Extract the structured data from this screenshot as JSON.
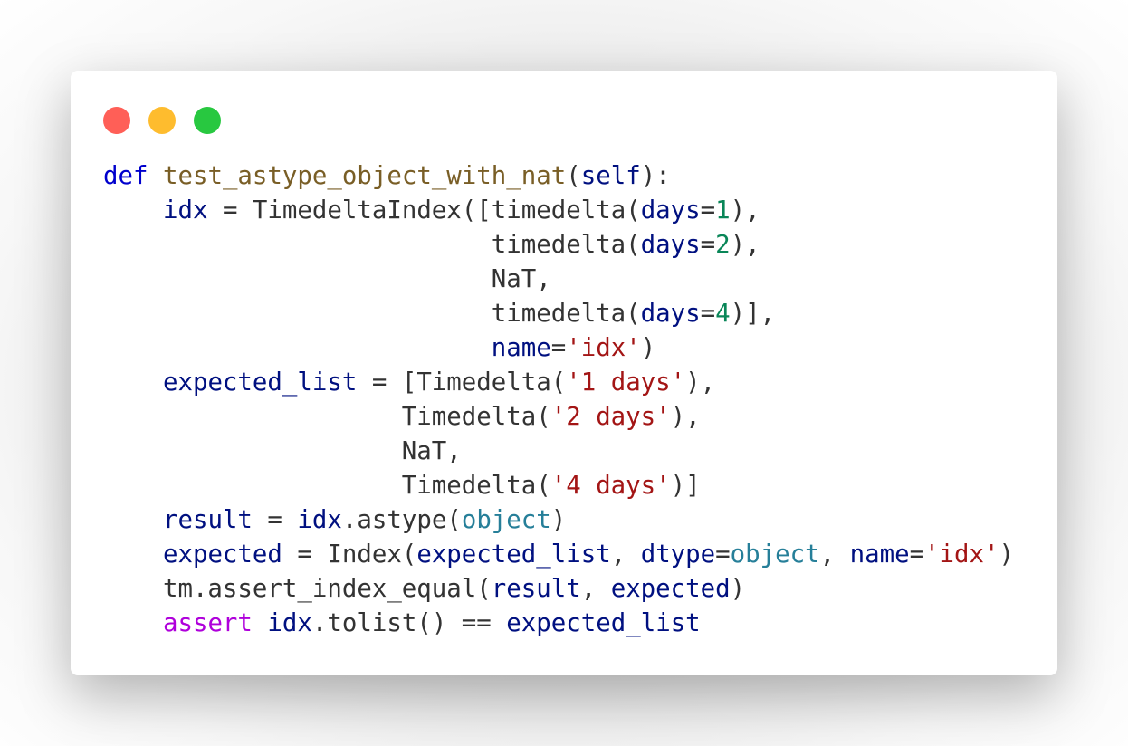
{
  "window": {
    "controls": {
      "close_color": "#ff5f57",
      "minimize_color": "#febc2e",
      "zoom_color": "#28c840"
    }
  },
  "colors": {
    "keyword": "#0000cd",
    "function_name": "#795e26",
    "variable": "#001080",
    "number": "#098658",
    "string": "#a31515",
    "builtin": "#267f99",
    "control": "#af00db",
    "default": "#333333"
  },
  "code": {
    "lines": [
      [
        {
          "text": "def",
          "cls": "kw"
        },
        {
          "text": " "
        },
        {
          "text": "test_astype_object_with_nat",
          "cls": "fn"
        },
        {
          "text": "("
        },
        {
          "text": "self",
          "cls": "var"
        },
        {
          "text": "):"
        }
      ],
      [
        {
          "text": "    "
        },
        {
          "text": "idx",
          "cls": "var"
        },
        {
          "text": " = TimedeltaIndex([timedelta("
        },
        {
          "text": "days",
          "cls": "var"
        },
        {
          "text": "="
        },
        {
          "text": "1",
          "cls": "num"
        },
        {
          "text": "),"
        }
      ],
      [
        {
          "text": "                          timedelta("
        },
        {
          "text": "days",
          "cls": "var"
        },
        {
          "text": "="
        },
        {
          "text": "2",
          "cls": "num"
        },
        {
          "text": "),"
        }
      ],
      [
        {
          "text": "                          NaT,"
        }
      ],
      [
        {
          "text": "                          timedelta("
        },
        {
          "text": "days",
          "cls": "var"
        },
        {
          "text": "="
        },
        {
          "text": "4",
          "cls": "num"
        },
        {
          "text": ")],"
        }
      ],
      [
        {
          "text": "                          "
        },
        {
          "text": "name",
          "cls": "var"
        },
        {
          "text": "="
        },
        {
          "text": "'idx'",
          "cls": "str"
        },
        {
          "text": ")"
        }
      ],
      [
        {
          "text": "    "
        },
        {
          "text": "expected_list",
          "cls": "var"
        },
        {
          "text": " = [Timedelta("
        },
        {
          "text": "'1 days'",
          "cls": "str"
        },
        {
          "text": "),"
        }
      ],
      [
        {
          "text": "                    Timedelta("
        },
        {
          "text": "'2 days'",
          "cls": "str"
        },
        {
          "text": "),"
        }
      ],
      [
        {
          "text": "                    NaT,"
        }
      ],
      [
        {
          "text": "                    Timedelta("
        },
        {
          "text": "'4 days'",
          "cls": "str"
        },
        {
          "text": ")]"
        }
      ],
      [
        {
          "text": "    "
        },
        {
          "text": "result",
          "cls": "var"
        },
        {
          "text": " = "
        },
        {
          "text": "idx",
          "cls": "var"
        },
        {
          "text": ".astype("
        },
        {
          "text": "object",
          "cls": "bi"
        },
        {
          "text": ")"
        }
      ],
      [
        {
          "text": "    "
        },
        {
          "text": "expected",
          "cls": "var"
        },
        {
          "text": " = Index("
        },
        {
          "text": "expected_list",
          "cls": "var"
        },
        {
          "text": ", "
        },
        {
          "text": "dtype",
          "cls": "var"
        },
        {
          "text": "="
        },
        {
          "text": "object",
          "cls": "bi"
        },
        {
          "text": ", "
        },
        {
          "text": "name",
          "cls": "var"
        },
        {
          "text": "="
        },
        {
          "text": "'idx'",
          "cls": "str"
        },
        {
          "text": ")"
        }
      ],
      [
        {
          "text": "    tm.assert_index_equal("
        },
        {
          "text": "result",
          "cls": "var"
        },
        {
          "text": ", "
        },
        {
          "text": "expected",
          "cls": "var"
        },
        {
          "text": ")"
        }
      ],
      [
        {
          "text": "    "
        },
        {
          "text": "assert",
          "cls": "ctl"
        },
        {
          "text": " "
        },
        {
          "text": "idx",
          "cls": "var"
        },
        {
          "text": ".tolist() == "
        },
        {
          "text": "expected_list",
          "cls": "var"
        }
      ]
    ]
  }
}
